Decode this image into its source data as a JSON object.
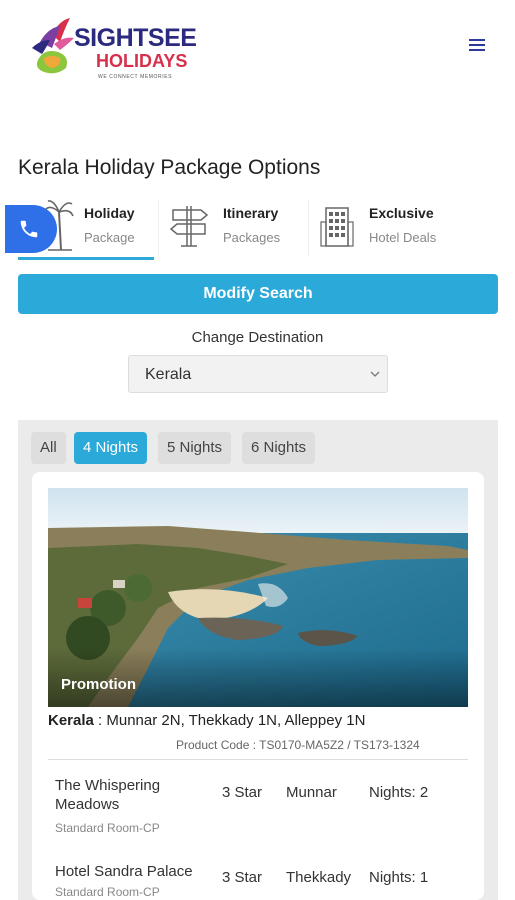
{
  "header": {
    "logo_line1": "SIGHTSEE",
    "logo_line2": "HOLIDAYS",
    "logo_tagline": "WE CONNECT MEMORIES"
  },
  "page_title": "Kerala Holiday Package Options",
  "tabs": [
    {
      "title": "Holiday",
      "subtitle": "Package",
      "icon": "palm-tree-icon",
      "active": true
    },
    {
      "title": "Itinerary",
      "subtitle": "Packages",
      "icon": "signpost-icon",
      "active": false
    },
    {
      "title": "Exclusive",
      "subtitle": "Hotel Deals",
      "icon": "building-icon",
      "active": false
    }
  ],
  "modify_search_label": "Modify Search",
  "change_destination_label": "Change Destination",
  "destination_select": {
    "value": "Kerala"
  },
  "night_filters": [
    {
      "label": "All",
      "active": false
    },
    {
      "label": "4 Nights",
      "active": true
    },
    {
      "label": "5 Nights",
      "active": false
    },
    {
      "label": "6 Nights",
      "active": false
    }
  ],
  "package": {
    "badge": "Promotion",
    "state": "Kerala",
    "route": " : Munnar 2N, Thekkady 1N, Alleppey 1N",
    "product_code": "Product Code : TS0170-MA5Z2 / TS173-1324",
    "hotels": [
      {
        "name": "The Whispering Meadows",
        "room": "Standard Room-CP",
        "stars": "3 Star",
        "city": "Munnar",
        "nights": "Nights: 2"
      },
      {
        "name": "Hotel Sandra Palace",
        "room": "Standard Room-CP",
        "stars": "3 Star",
        "city": "Thekkady",
        "nights": "Nights: 1"
      }
    ]
  },
  "colors": {
    "brand_navy": "#2b2a7e",
    "brand_red": "#d6304d",
    "accent_blue": "#2ba9d9",
    "call_button": "#2f6fe8"
  }
}
